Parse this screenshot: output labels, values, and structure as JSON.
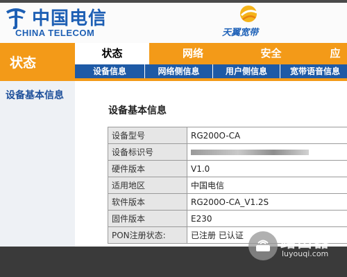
{
  "brand": {
    "logo_cn": "中国电信",
    "logo_en": "CHINA TELECOM",
    "partner": "天翼宽带"
  },
  "sidebar": {
    "title": "状态",
    "items": [
      {
        "label": "设备基本信息"
      }
    ]
  },
  "tabs": [
    {
      "label": "状态",
      "active": true
    },
    {
      "label": "网络",
      "active": false
    },
    {
      "label": "安全",
      "active": false
    },
    {
      "label": "应",
      "active": false
    }
  ],
  "subtabs": [
    {
      "label": "设备信息"
    },
    {
      "label": "网络侧信息"
    },
    {
      "label": "用户侧信息"
    },
    {
      "label": "宽带语音信息"
    }
  ],
  "main": {
    "section_title": "设备基本信息",
    "rows": [
      {
        "label": "设备型号",
        "value": "RG200O-CA"
      },
      {
        "label": "设备标识号",
        "value": ""
      },
      {
        "label": "硬件版本",
        "value": "V1.0"
      },
      {
        "label": "适用地区",
        "value": "中国电信"
      },
      {
        "label": "软件版本",
        "value": "RG200O-CA_V1.2S"
      },
      {
        "label": "固件版本",
        "value": "E230"
      },
      {
        "label": "PON注册状态:",
        "value": "已注册 已认证"
      }
    ]
  },
  "watermark": {
    "cn": "路由器",
    "url": "luyouqi.com"
  },
  "colors": {
    "orange": "#f39a18",
    "blue": "#1e5aa6",
    "brand_blue": "#1d5fb4"
  }
}
